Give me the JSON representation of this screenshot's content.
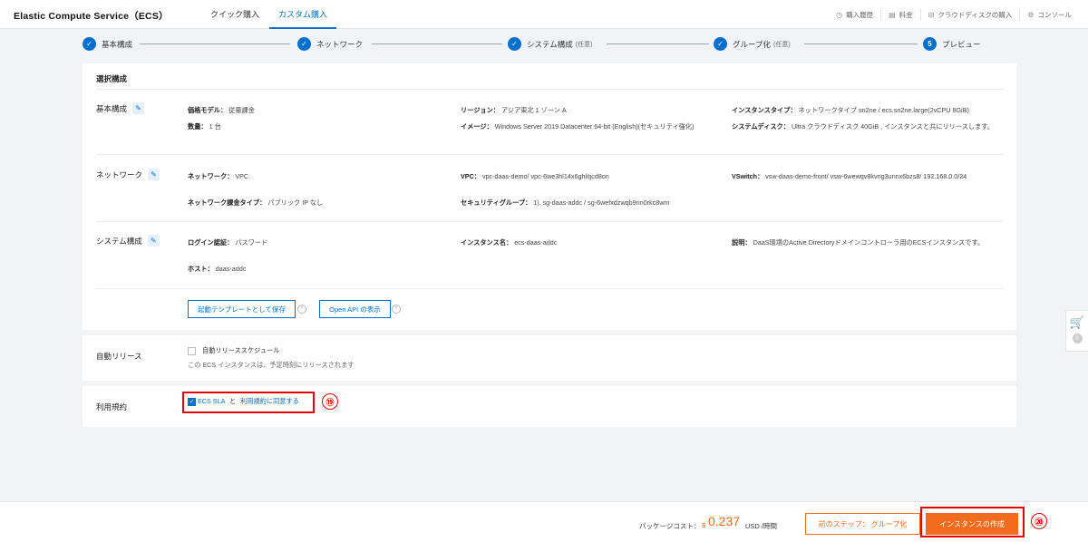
{
  "header": {
    "title": "Elastic Compute Service（ECS）",
    "tabs": [
      {
        "label": "クイック購入"
      },
      {
        "label": "カスタム購入"
      }
    ],
    "links": [
      {
        "icon": "clock-icon",
        "label": "購入履歴"
      },
      {
        "icon": "calculator-icon",
        "label": "料金"
      },
      {
        "icon": "disk-icon",
        "label": "クラウドディスクの購入"
      },
      {
        "icon": "gear-icon",
        "label": "コンソール"
      }
    ]
  },
  "steps": [
    {
      "num": "✓",
      "label": "基本構成",
      "optional": ""
    },
    {
      "num": "✓",
      "label": "ネットワーク",
      "optional": ""
    },
    {
      "num": "✓",
      "label": "システム構成",
      "optional": "(任意)"
    },
    {
      "num": "✓",
      "label": "グループ化",
      "optional": "(任意)"
    },
    {
      "num": "5",
      "label": "プレビュー",
      "optional": ""
    }
  ],
  "summary": {
    "title": "選択構成",
    "basic": {
      "label": "基本構成",
      "billing_key": "価格モデル：",
      "billing_val": "従量課金",
      "qty_key": "数量：",
      "qty_val": "1 台",
      "region_key": "リージョン：",
      "region_val": "アジア東北 1 ゾーン A",
      "image_key": "イメージ：",
      "image_val": "Windows Server 2019 Datacenter 64-bit (English)(セキュリティ強化)",
      "type_key": "インスタンスタイプ：",
      "type_val": "ネットワークタイプ sn2ne / ecs.sn2ne.large(2vCPU 8GiB)",
      "disk_key": "システムディスク：",
      "disk_val": "Ultra クラウドディスク 40GiB , インスタンスと共にリリースします。"
    },
    "network": {
      "label": "ネットワーク",
      "net_key": "ネットワーク：",
      "net_val": "VPC",
      "bill_key": "ネットワーク課金タイプ：",
      "bill_val": "パブリック IP なし",
      "vpc_key": "VPC：",
      "vpc_val": "vpc-daas-demo/ vpc-6we3hl14x6ghlitjcd8on",
      "sg_key": "セキュリティグループ：",
      "sg_val": "1). sg-daas-addc / sg-6wefxdzwqb9nn0rkc8wm",
      "vsw_key": "VSwitch：",
      "vsw_val": "vsw-daas-demo-front/ vsw-6wewqv8kvng3unnx6bzs8/ 192.168.0.0/24"
    },
    "system": {
      "label": "システム構成",
      "login_key": "ログイン認証：",
      "login_val": "パスワード",
      "host_key": "ホスト：",
      "host_val": "daas-addc",
      "name_key": "インスタンス名：",
      "name_val": "ecs-daas-addc",
      "desc_key": "説明：",
      "desc_val": "DaaS環境のActive Directoryドメインコントローラ用のECSインスタンスです。"
    },
    "save_template": "起動テンプレートとして保存",
    "open_api": "Open API の表示"
  },
  "auto_release": {
    "label": "自動リリース",
    "option": "自動リリーススケジュール",
    "note": "この ECS インスタンスは、予定時刻にリリースされます"
  },
  "terms": {
    "label": "利用規約",
    "sla": "ECS SLA",
    "and": "と",
    "agree": "利用規約に同意する",
    "marker": "⑲"
  },
  "cart": {
    "count": "0"
  },
  "footer": {
    "cost_label": "パッケージコスト：",
    "currency": "$",
    "cost_value": "0.237",
    "cost_unit": "USD /時間",
    "prev_button": "前のステップ：  グループ化",
    "create_button": "インスタンスの作成",
    "marker": "⑳"
  },
  "colors": {
    "accent": "#0070cc",
    "orange": "#f36b1c",
    "annotation": "#e60000"
  }
}
